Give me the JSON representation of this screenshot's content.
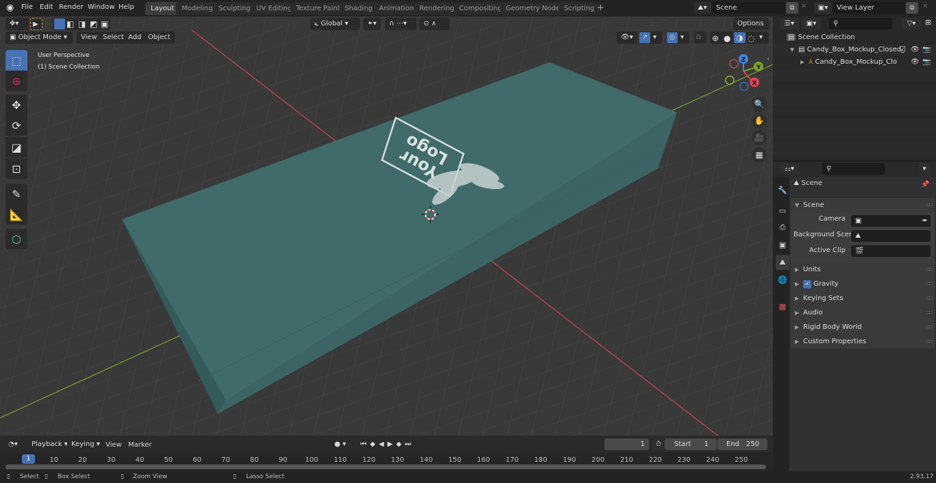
{
  "topbar": {
    "menus": [
      "File",
      "Edit",
      "Render",
      "Window",
      "Help"
    ],
    "workspaces": [
      "Layout",
      "Modeling",
      "Sculpting",
      "UV Editing",
      "Texture Paint",
      "Shading",
      "Animation",
      "Rendering",
      "Compositing",
      "Geometry Nodes",
      "Scripting"
    ],
    "active_workspace": "Layout",
    "add_workspace": "+",
    "scene_name": "Scene",
    "view_layer_name": "View Layer"
  },
  "viewport": {
    "mode": "Object Mode",
    "menus": [
      "View",
      "Select",
      "Add",
      "Object"
    ],
    "transform_orientation": "Global",
    "options_label": "Options",
    "overlay_title": "User Perspective",
    "overlay_subtitle": "(1) Scene Collection",
    "tools": [
      "select-box",
      "cursor",
      "move",
      "rotate",
      "scale",
      "transform",
      "annotate",
      "measure",
      "add-cube"
    ],
    "gizmo_axes": {
      "x": "X",
      "y": "Y",
      "z": "Z"
    },
    "colors": {
      "x_axis": "#e2434f",
      "y_axis": "#7ea12a",
      "z_axis": "#3d87e0",
      "box": "#3f6a6a",
      "select_active": "#4772b3"
    },
    "object_logo_text": [
      "Your",
      "Logo"
    ]
  },
  "outliner": {
    "search_placeholder": "",
    "root": "Scene Collection",
    "items": [
      {
        "label": "Candy_Box_Mockup_Closed_",
        "type": "collection",
        "checked": true
      },
      {
        "label": "Candy_Box_Mockup_Clo",
        "type": "object"
      }
    ]
  },
  "properties": {
    "search_placeholder": "",
    "context_title": "Scene",
    "panel_title": "Scene",
    "fields": [
      {
        "label": "Camera",
        "value": ""
      },
      {
        "label": "Background Scene",
        "value": ""
      },
      {
        "label": "Active Clip",
        "value": ""
      }
    ],
    "sections": [
      "Units",
      "Gravity",
      "Keying Sets",
      "Audio",
      "Rigid Body World",
      "Custom Properties"
    ],
    "gravity_checked": true,
    "tabs": [
      "tool",
      "render",
      "output",
      "view-layer",
      "scene",
      "world",
      "texture"
    ]
  },
  "timeline": {
    "menus": [
      "Playback",
      "Keying",
      "View",
      "Marker"
    ],
    "current_frame": "1",
    "start_label": "Start",
    "start_value": "1",
    "end_label": "End",
    "end_value": "250",
    "ticks": [
      "10",
      "20",
      "30",
      "40",
      "50",
      "60",
      "70",
      "80",
      "90",
      "100",
      "110",
      "120",
      "130",
      "140",
      "150",
      "160",
      "170",
      "180",
      "190",
      "200",
      "210",
      "220",
      "230",
      "240",
      "250"
    ],
    "playhead": "1"
  },
  "statusbar": {
    "hints": [
      "Select",
      "Box Select",
      "Zoom View",
      "Lasso Select"
    ],
    "version": "2.93.17"
  }
}
